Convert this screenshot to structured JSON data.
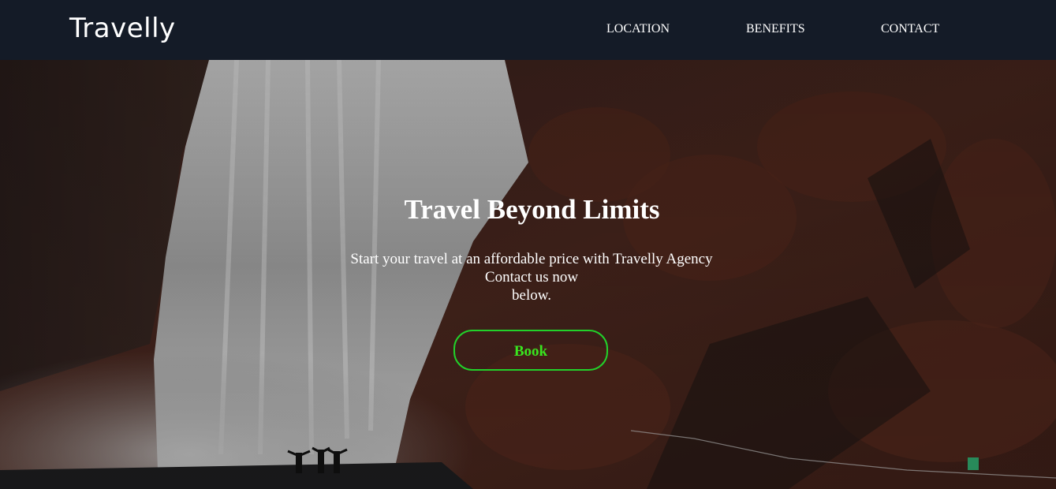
{
  "navbar": {
    "brand": "Travelly",
    "links": [
      "LOCATION",
      "BENEFITS",
      "CONTACT"
    ]
  },
  "hero": {
    "title": "Travel Beyond Limits",
    "subtitle_lines": [
      "Start your travel at an affordable price with Travelly Agency",
      "Contact us now",
      "below."
    ],
    "button_label": "Book"
  },
  "colors": {
    "navbar_bg": "#141b27",
    "text": "#ffffff",
    "button_accent": "#22d12a",
    "button_text": "#39e61f"
  }
}
